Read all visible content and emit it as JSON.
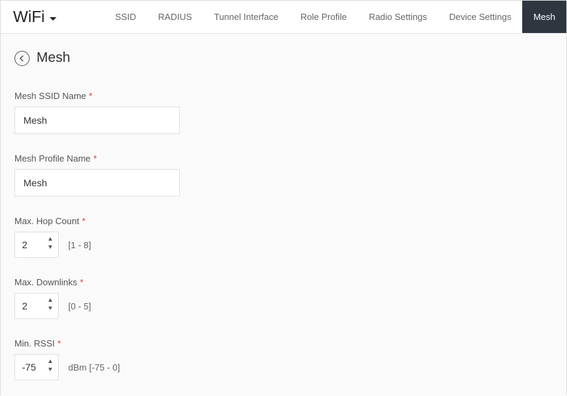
{
  "brand": {
    "title": "WiFi"
  },
  "tabs": [
    {
      "label": "SSID"
    },
    {
      "label": "RADIUS"
    },
    {
      "label": "Tunnel Interface"
    },
    {
      "label": "Role Profile"
    },
    {
      "label": "Radio Settings"
    },
    {
      "label": "Device Settings"
    },
    {
      "label": "Mesh",
      "active": true
    }
  ],
  "page": {
    "title": "Mesh"
  },
  "form": {
    "ssid_name": {
      "label": "Mesh SSID Name",
      "value": "Mesh",
      "required": true
    },
    "profile_name": {
      "label": "Mesh Profile Name",
      "value": "Mesh",
      "required": true
    },
    "max_hop": {
      "label": "Max. Hop Count",
      "value": "2",
      "hint": "[1 - 8]",
      "required": true
    },
    "max_downlinks": {
      "label": "Max. Downlinks",
      "value": "2",
      "hint": "[0 - 5]",
      "required": true
    },
    "min_rssi": {
      "label": "Min. RSSI",
      "value": "-75",
      "hint": "dBm [-75 - 0]",
      "required": true
    }
  },
  "required_marker": "*"
}
